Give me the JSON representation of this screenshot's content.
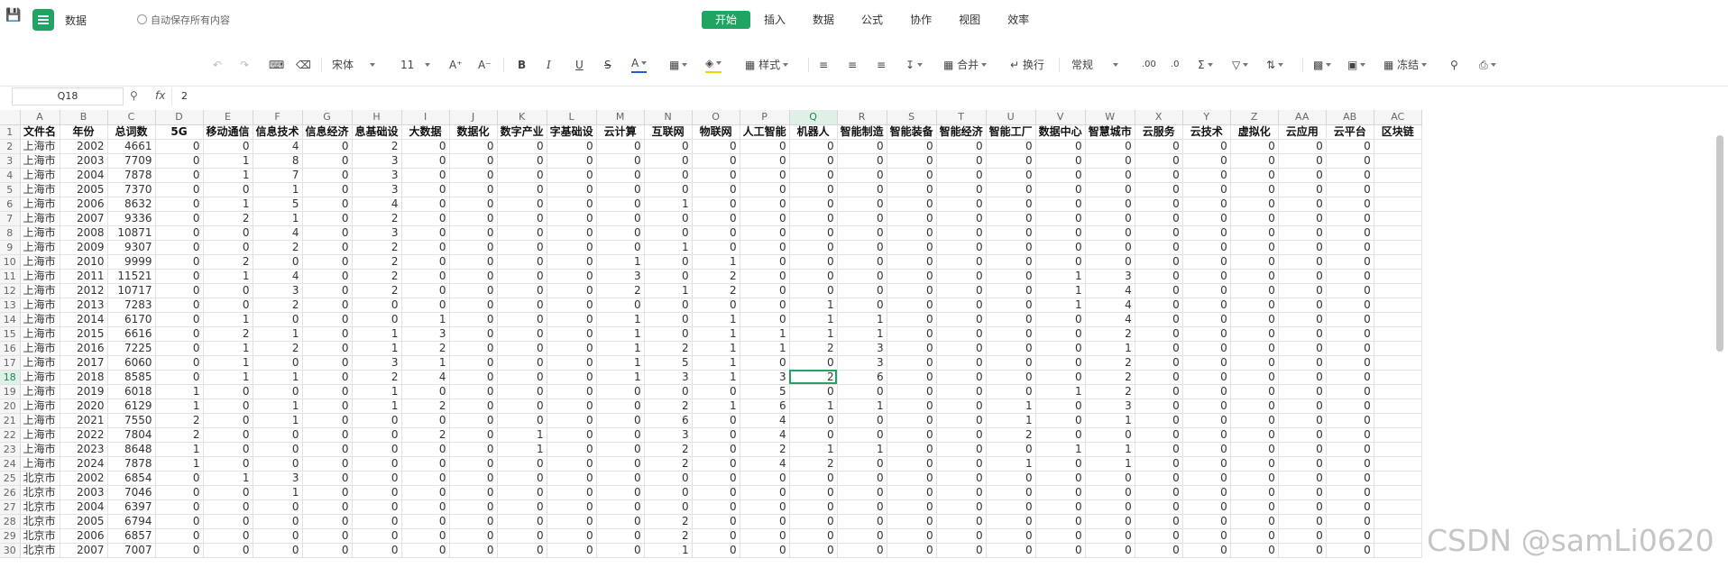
{
  "header": {
    "doc_title": "数据",
    "autosave": "自动保存所有内容",
    "tabs": [
      "开始",
      "插入",
      "数据",
      "公式",
      "协作",
      "视图",
      "效率"
    ],
    "active_tab": "开始"
  },
  "toolbar": {
    "font": "宋体",
    "size": "11",
    "grow_font": "A⁺",
    "shrink_font": "A⁻",
    "bold": "B",
    "italic": "I",
    "underline": "U",
    "strike": "S",
    "font_color": "A",
    "style": "样式",
    "merge": "合并",
    "wrap": "换行",
    "numfmt": "常规",
    "freeze": "冻结"
  },
  "formula_bar": {
    "cell_ref": "Q18",
    "fx": "fx",
    "value": "2"
  },
  "colors": {
    "accent": "#1fa463"
  },
  "sheet": {
    "columns": [
      "A",
      "B",
      "C",
      "D",
      "E",
      "F",
      "G",
      "H",
      "I",
      "J",
      "K",
      "L",
      "M",
      "N",
      "O",
      "P",
      "Q",
      "R",
      "S",
      "T",
      "U",
      "V",
      "W",
      "X",
      "Y",
      "Z",
      "AA",
      "AB",
      "AC"
    ],
    "selected_col": "Q",
    "selected_row": 18,
    "header": [
      "文件名",
      "年份",
      "总词数",
      "5G",
      "移动通信",
      "信息技术",
      "信息经济",
      "息基础设",
      "大数据",
      "数据化",
      "数字产业",
      "字基础设",
      "云计算",
      "互联网",
      "物联网",
      "人工智能",
      "机器人",
      "智能制造",
      "智能装备",
      "智能经济",
      "智能工厂",
      "数据中心",
      "智慧城市",
      "云服务",
      "云技术",
      "虚拟化",
      "云应用",
      "云平台",
      "区块链"
    ],
    "rows": [
      [
        "上海市",
        "2002",
        "4661",
        "0",
        "0",
        "4",
        "0",
        "2",
        "0",
        "0",
        "0",
        "0",
        "0",
        "0",
        "0",
        "0",
        "0",
        "0",
        "0",
        "0",
        "0",
        "0",
        "0",
        "0",
        "0",
        "0",
        "0",
        "0",
        ""
      ],
      [
        "上海市",
        "2003",
        "7709",
        "0",
        "1",
        "8",
        "0",
        "3",
        "0",
        "0",
        "0",
        "0",
        "0",
        "0",
        "0",
        "0",
        "0",
        "0",
        "0",
        "0",
        "0",
        "0",
        "0",
        "0",
        "0",
        "0",
        "0",
        "0",
        ""
      ],
      [
        "上海市",
        "2004",
        "7878",
        "0",
        "1",
        "7",
        "0",
        "3",
        "0",
        "0",
        "0",
        "0",
        "0",
        "0",
        "0",
        "0",
        "0",
        "0",
        "0",
        "0",
        "0",
        "0",
        "0",
        "0",
        "0",
        "0",
        "0",
        "0",
        ""
      ],
      [
        "上海市",
        "2005",
        "7370",
        "0",
        "0",
        "1",
        "0",
        "3",
        "0",
        "0",
        "0",
        "0",
        "0",
        "0",
        "0",
        "0",
        "0",
        "0",
        "0",
        "0",
        "0",
        "0",
        "0",
        "0",
        "0",
        "0",
        "0",
        "0",
        ""
      ],
      [
        "上海市",
        "2006",
        "8632",
        "0",
        "1",
        "5",
        "0",
        "4",
        "0",
        "0",
        "0",
        "0",
        "0",
        "1",
        "0",
        "0",
        "0",
        "0",
        "0",
        "0",
        "0",
        "0",
        "0",
        "0",
        "0",
        "0",
        "0",
        "0",
        ""
      ],
      [
        "上海市",
        "2007",
        "9336",
        "0",
        "2",
        "1",
        "0",
        "2",
        "0",
        "0",
        "0",
        "0",
        "0",
        "0",
        "0",
        "0",
        "0",
        "0",
        "0",
        "0",
        "0",
        "0",
        "0",
        "0",
        "0",
        "0",
        "0",
        "0",
        ""
      ],
      [
        "上海市",
        "2008",
        "10871",
        "0",
        "0",
        "4",
        "0",
        "3",
        "0",
        "0",
        "0",
        "0",
        "0",
        "0",
        "0",
        "0",
        "0",
        "0",
        "0",
        "0",
        "0",
        "0",
        "0",
        "0",
        "0",
        "0",
        "0",
        "0",
        ""
      ],
      [
        "上海市",
        "2009",
        "9307",
        "0",
        "0",
        "2",
        "0",
        "2",
        "0",
        "0",
        "0",
        "0",
        "0",
        "1",
        "0",
        "0",
        "0",
        "0",
        "0",
        "0",
        "0",
        "0",
        "0",
        "0",
        "0",
        "0",
        "0",
        "0",
        ""
      ],
      [
        "上海市",
        "2010",
        "9999",
        "0",
        "2",
        "0",
        "0",
        "2",
        "0",
        "0",
        "0",
        "0",
        "1",
        "0",
        "1",
        "0",
        "0",
        "0",
        "0",
        "0",
        "0",
        "0",
        "0",
        "0",
        "0",
        "0",
        "0",
        "0",
        ""
      ],
      [
        "上海市",
        "2011",
        "11521",
        "0",
        "1",
        "4",
        "0",
        "2",
        "0",
        "0",
        "0",
        "0",
        "3",
        "0",
        "2",
        "0",
        "0",
        "0",
        "0",
        "0",
        "0",
        "1",
        "3",
        "0",
        "0",
        "0",
        "0",
        "0",
        ""
      ],
      [
        "上海市",
        "2012",
        "10717",
        "0",
        "0",
        "3",
        "0",
        "2",
        "0",
        "0",
        "0",
        "0",
        "2",
        "1",
        "2",
        "0",
        "0",
        "0",
        "0",
        "0",
        "0",
        "1",
        "4",
        "0",
        "0",
        "0",
        "0",
        "0",
        ""
      ],
      [
        "上海市",
        "2013",
        "7283",
        "0",
        "0",
        "2",
        "0",
        "0",
        "0",
        "0",
        "0",
        "0",
        "0",
        "0",
        "0",
        "0",
        "1",
        "0",
        "0",
        "0",
        "0",
        "1",
        "4",
        "0",
        "0",
        "0",
        "0",
        "0",
        ""
      ],
      [
        "上海市",
        "2014",
        "6170",
        "0",
        "1",
        "0",
        "0",
        "0",
        "1",
        "0",
        "0",
        "0",
        "1",
        "0",
        "1",
        "0",
        "1",
        "1",
        "0",
        "0",
        "0",
        "0",
        "4",
        "0",
        "0",
        "0",
        "0",
        "0",
        ""
      ],
      [
        "上海市",
        "2015",
        "6616",
        "0",
        "2",
        "1",
        "0",
        "1",
        "3",
        "0",
        "0",
        "0",
        "1",
        "0",
        "1",
        "1",
        "1",
        "1",
        "0",
        "0",
        "0",
        "0",
        "2",
        "0",
        "0",
        "0",
        "0",
        "0",
        ""
      ],
      [
        "上海市",
        "2016",
        "7225",
        "0",
        "1",
        "2",
        "0",
        "1",
        "2",
        "0",
        "0",
        "0",
        "1",
        "2",
        "1",
        "1",
        "2",
        "3",
        "0",
        "0",
        "0",
        "0",
        "1",
        "0",
        "0",
        "0",
        "0",
        "0",
        ""
      ],
      [
        "上海市",
        "2017",
        "6060",
        "0",
        "1",
        "0",
        "0",
        "3",
        "1",
        "0",
        "0",
        "0",
        "1",
        "5",
        "1",
        "0",
        "0",
        "3",
        "0",
        "0",
        "0",
        "0",
        "2",
        "0",
        "0",
        "0",
        "0",
        "0",
        ""
      ],
      [
        "上海市",
        "2018",
        "8585",
        "0",
        "1",
        "1",
        "0",
        "2",
        "4",
        "0",
        "0",
        "0",
        "1",
        "3",
        "1",
        "3",
        "2",
        "6",
        "0",
        "0",
        "0",
        "0",
        "2",
        "0",
        "0",
        "0",
        "0",
        "0",
        ""
      ],
      [
        "上海市",
        "2019",
        "6018",
        "1",
        "0",
        "0",
        "0",
        "1",
        "0",
        "0",
        "0",
        "0",
        "0",
        "0",
        "0",
        "5",
        "0",
        "0",
        "0",
        "0",
        "0",
        "1",
        "2",
        "0",
        "0",
        "0",
        "0",
        "0",
        ""
      ],
      [
        "上海市",
        "2020",
        "6129",
        "1",
        "0",
        "1",
        "0",
        "1",
        "2",
        "0",
        "0",
        "0",
        "0",
        "2",
        "1",
        "6",
        "1",
        "1",
        "0",
        "0",
        "1",
        "0",
        "3",
        "0",
        "0",
        "0",
        "0",
        "0",
        ""
      ],
      [
        "上海市",
        "2021",
        "7550",
        "2",
        "0",
        "1",
        "0",
        "0",
        "0",
        "0",
        "0",
        "0",
        "0",
        "6",
        "0",
        "4",
        "0",
        "0",
        "0",
        "0",
        "1",
        "0",
        "1",
        "0",
        "0",
        "0",
        "0",
        "0",
        ""
      ],
      [
        "上海市",
        "2022",
        "7804",
        "2",
        "0",
        "0",
        "0",
        "0",
        "2",
        "0",
        "1",
        "0",
        "0",
        "3",
        "0",
        "4",
        "0",
        "0",
        "0",
        "0",
        "2",
        "0",
        "0",
        "0",
        "0",
        "0",
        "0",
        "0",
        ""
      ],
      [
        "上海市",
        "2023",
        "8648",
        "1",
        "0",
        "0",
        "0",
        "0",
        "0",
        "0",
        "1",
        "0",
        "0",
        "2",
        "0",
        "2",
        "1",
        "1",
        "0",
        "0",
        "0",
        "1",
        "1",
        "0",
        "0",
        "0",
        "0",
        "0",
        ""
      ],
      [
        "上海市",
        "2024",
        "7878",
        "1",
        "0",
        "0",
        "0",
        "0",
        "0",
        "0",
        "0",
        "0",
        "0",
        "2",
        "0",
        "4",
        "2",
        "0",
        "0",
        "0",
        "1",
        "0",
        "1",
        "0",
        "0",
        "0",
        "0",
        "0",
        ""
      ],
      [
        "北京市",
        "2002",
        "6854",
        "0",
        "1",
        "3",
        "0",
        "0",
        "0",
        "0",
        "0",
        "0",
        "0",
        "0",
        "0",
        "0",
        "0",
        "0",
        "0",
        "0",
        "0",
        "0",
        "0",
        "0",
        "0",
        "0",
        "0",
        "0",
        ""
      ],
      [
        "北京市",
        "2003",
        "7046",
        "0",
        "0",
        "1",
        "0",
        "0",
        "0",
        "0",
        "0",
        "0",
        "0",
        "0",
        "0",
        "0",
        "0",
        "0",
        "0",
        "0",
        "0",
        "0",
        "0",
        "0",
        "0",
        "0",
        "0",
        "0",
        ""
      ],
      [
        "北京市",
        "2004",
        "6397",
        "0",
        "0",
        "0",
        "0",
        "0",
        "0",
        "0",
        "0",
        "0",
        "0",
        "0",
        "0",
        "0",
        "0",
        "0",
        "0",
        "0",
        "0",
        "0",
        "0",
        "0",
        "0",
        "0",
        "0",
        "0",
        ""
      ],
      [
        "北京市",
        "2005",
        "6794",
        "0",
        "0",
        "0",
        "0",
        "0",
        "0",
        "0",
        "0",
        "0",
        "0",
        "2",
        "0",
        "0",
        "0",
        "0",
        "0",
        "0",
        "0",
        "0",
        "0",
        "0",
        "0",
        "0",
        "0",
        "0",
        ""
      ],
      [
        "北京市",
        "2006",
        "6857",
        "0",
        "0",
        "0",
        "0",
        "0",
        "0",
        "0",
        "0",
        "0",
        "0",
        "2",
        "0",
        "0",
        "0",
        "0",
        "0",
        "0",
        "0",
        "0",
        "0",
        "0",
        "0",
        "0",
        "0",
        "0",
        ""
      ],
      [
        "北京市",
        "2007",
        "7007",
        "0",
        "0",
        "0",
        "0",
        "0",
        "0",
        "0",
        "0",
        "0",
        "0",
        "1",
        "0",
        "0",
        "0",
        "0",
        "0",
        "0",
        "0",
        "0",
        "0",
        "0",
        "0",
        "0",
        "0",
        "0",
        ""
      ]
    ]
  },
  "watermark": "CSDN @samLi0620"
}
